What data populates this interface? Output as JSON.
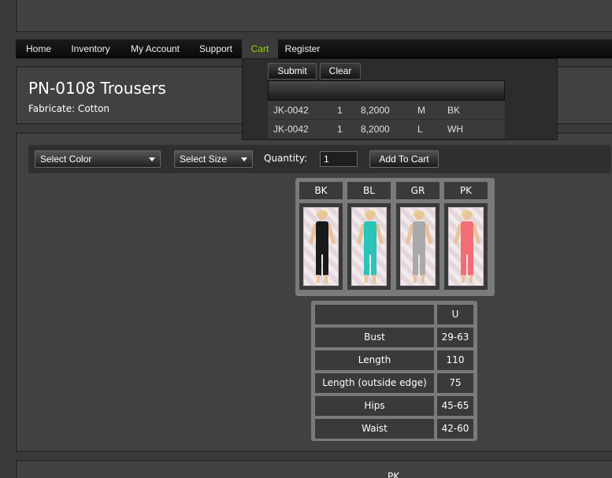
{
  "nav": {
    "items": [
      {
        "label": "Home"
      },
      {
        "label": "Inventory"
      },
      {
        "label": "My Account"
      },
      {
        "label": "Support"
      },
      {
        "label": "Cart"
      },
      {
        "label": "Register"
      }
    ],
    "active": "Cart",
    "active_color": "#8fd400"
  },
  "product": {
    "title": "PN-0108 Trousers",
    "fabric": "Fabricate: Cotton"
  },
  "cart": {
    "submit_label": "Submit",
    "clear_label": "Clear",
    "rows": [
      {
        "code": "JK-0042",
        "qty": "1",
        "price": "8,2000",
        "size": "M",
        "color": "BK"
      },
      {
        "code": "JK-0042",
        "qty": "1",
        "price": "8,2000",
        "size": "L",
        "color": "WH"
      }
    ]
  },
  "controls": {
    "color_select": "Select Color",
    "size_select": "Select Size",
    "quantity_label": "Quantity:",
    "quantity_value": "1",
    "add_to_cart_label": "Add To Cart"
  },
  "colors": [
    {
      "code": "BK",
      "swatch": "#1a1a1a"
    },
    {
      "code": "BL",
      "swatch": "#2bc4b8"
    },
    {
      "code": "GR",
      "swatch": "#a9a9a9"
    },
    {
      "code": "PK",
      "swatch": "#f26d74"
    }
  ],
  "size_table": {
    "size_header": "U",
    "rows": [
      {
        "measure": "Bust",
        "value": "29-63"
      },
      {
        "measure": "Length",
        "value": "110"
      },
      {
        "measure": "Length (outside edge)",
        "value": "75"
      },
      {
        "measure": "Hips",
        "value": "45-65"
      },
      {
        "measure": "Waist",
        "value": "42-60"
      }
    ]
  },
  "bottom": {
    "label": "PK"
  }
}
